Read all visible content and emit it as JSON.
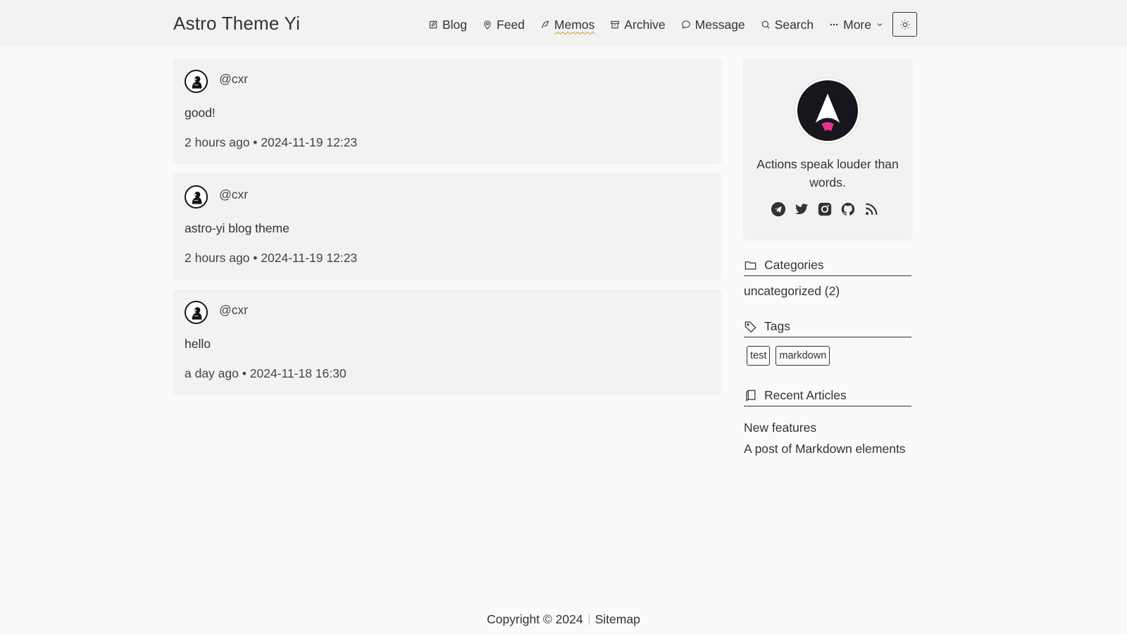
{
  "site": {
    "title": "Astro Theme Yi"
  },
  "nav": {
    "items": [
      {
        "label": "Blog",
        "icon": "edit-icon"
      },
      {
        "label": "Feed",
        "icon": "map-pin-icon"
      },
      {
        "label": "Memos",
        "icon": "feather-icon",
        "active": true
      },
      {
        "label": "Archive",
        "icon": "archive-icon"
      },
      {
        "label": "Message",
        "icon": "message-icon"
      },
      {
        "label": "Search",
        "icon": "search-icon"
      },
      {
        "label": "More",
        "icon": "dots-icon"
      }
    ],
    "theme_toggle_icon": "sun-icon"
  },
  "memos": [
    {
      "user": "@cxr",
      "content": "good!",
      "meta": "2 hours ago • 2024-11-19 12:23"
    },
    {
      "user": "@cxr",
      "content": "astro-yi blog theme",
      "meta": "2 hours ago • 2024-11-19 12:23"
    },
    {
      "user": "@cxr",
      "content": "hello",
      "meta": "a day ago • 2024-11-18 16:30"
    }
  ],
  "profile": {
    "motto": "Actions speak louder than words.",
    "socials": [
      "telegram-icon",
      "twitter-icon",
      "instagram-icon",
      "github-icon",
      "rss-icon"
    ]
  },
  "sidebar": {
    "categories": {
      "title": "Categories",
      "items": [
        "uncategorized (2)"
      ]
    },
    "tags": {
      "title": "Tags",
      "items": [
        "test",
        "markdown"
      ]
    },
    "recent": {
      "title": "Recent Articles",
      "items": [
        "New features",
        "A post of Markdown elements"
      ]
    }
  },
  "footer": {
    "copyright": "Copyright © 2024",
    "sitemap": "Sitemap"
  },
  "colors": {
    "accent_underline": "#d4901e",
    "header_bg": "#f2f2f2",
    "page_bg": "#fafafa",
    "card_bg": "#f2f2f2",
    "text": "#333333"
  }
}
